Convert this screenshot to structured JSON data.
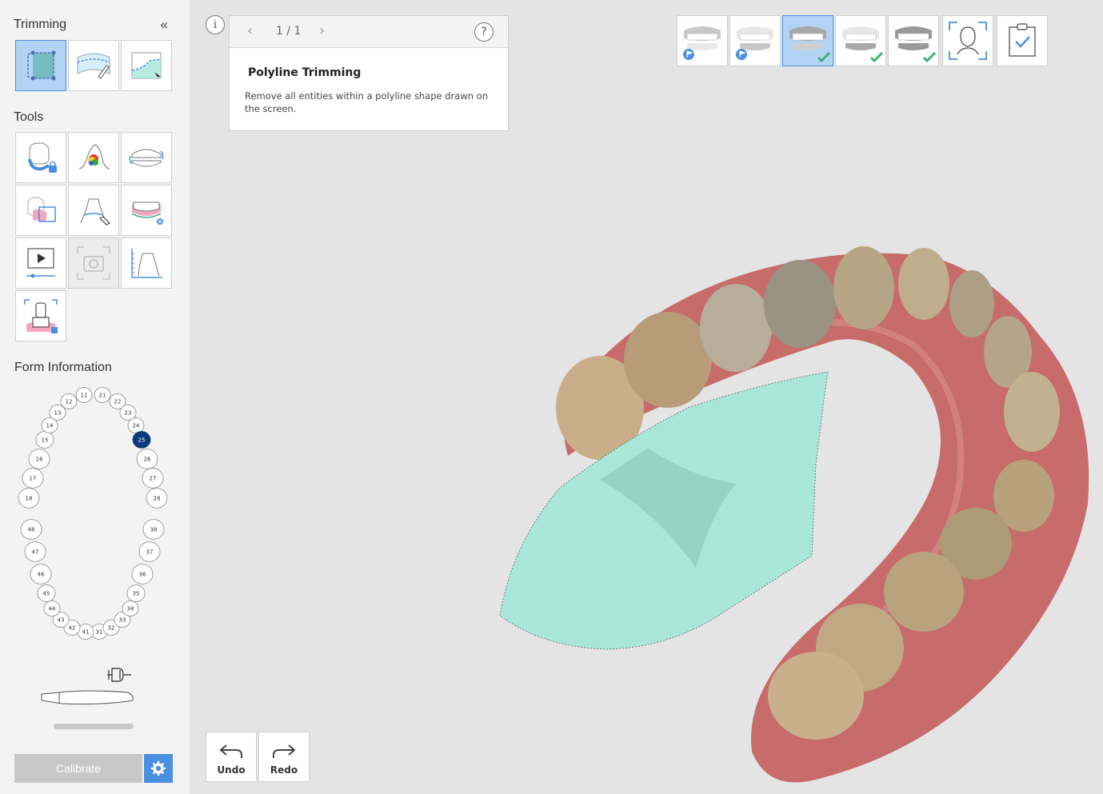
{
  "sidebar": {
    "trimming_title": "Trimming",
    "tools_title": "Tools",
    "form_title": "Form Information",
    "collapse_icon": "«",
    "calibrate_label": "Calibrate",
    "selected_tooth": "25",
    "teeth_upper_right": [
      "18",
      "17",
      "16",
      "15",
      "14",
      "13",
      "12",
      "11"
    ],
    "teeth_upper_left": [
      "21",
      "22",
      "23",
      "24",
      "25",
      "26",
      "27",
      "28"
    ],
    "teeth_lower_left": [
      "31",
      "32",
      "33",
      "34",
      "35",
      "36",
      "37",
      "38"
    ],
    "teeth_lower_right": [
      "41",
      "42",
      "43",
      "44",
      "45",
      "46",
      "47",
      "48"
    ]
  },
  "info": {
    "icon": "i",
    "page": "1 / 1",
    "prev": "‹",
    "next": "›",
    "help": "?",
    "title": "Polyline Trimming",
    "description": "Remove all entities within a polyline shape drawn on the screen."
  },
  "history": {
    "undo_label": "Undo",
    "redo_label": "Redo"
  },
  "colors": {
    "accent": "#4a90e2",
    "active_bg": "#b3d3f5",
    "check": "#3cb371",
    "trim_region": "#a8e6d8",
    "selected_tooth": "#0d3a7a"
  }
}
